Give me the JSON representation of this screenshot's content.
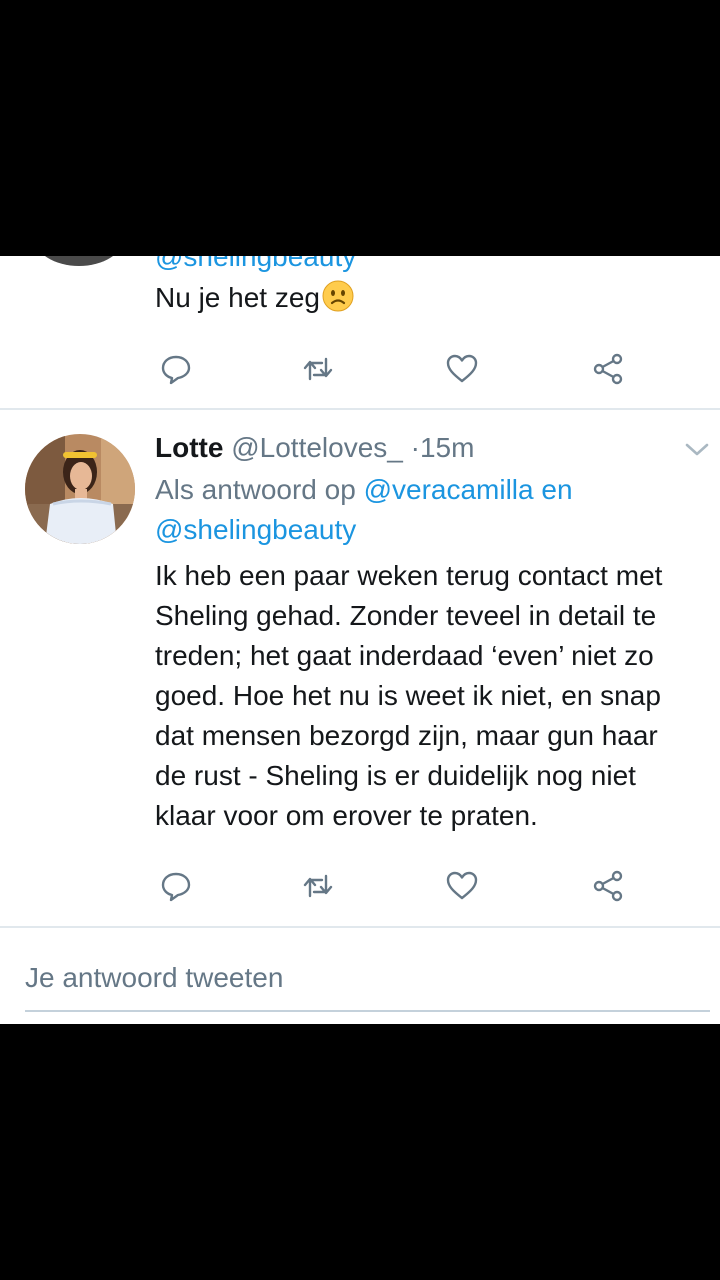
{
  "previous_tweet": {
    "mention_cutoff": "@shelingbeauty",
    "text": "Nu je het zeg",
    "emoji": "frowning-face-emoji"
  },
  "tweet": {
    "name": "Lotte",
    "handle": "@Lotteloves_",
    "separator": "·",
    "time": "15m",
    "reply_prefix": "Als antwoord op",
    "reply_mention_1": "@veracamilla",
    "reply_conjunction": "en",
    "reply_mention_2": "@shelingbeauty",
    "body_lines": [
      "Ik heb een paar weken terug contact met",
      "Sheling gehad. Zonder teveel in detail te",
      "treden; het gaat inderdaad ‘even’ niet zo",
      "goed. Hoe het nu is weet ik niet, en snap",
      "dat mensen bezorgd zijn, maar gun haar",
      "de rust - Sheling is er duidelijk nog niet",
      "klaar voor om erover te praten."
    ]
  },
  "actions": [
    "reply-icon",
    "retweet-icon",
    "like-icon",
    "share-icon"
  ],
  "compose": {
    "placeholder": "Je antwoord tweeten"
  },
  "colors": {
    "link": "#1b95e0",
    "secondary": "#657786",
    "text": "#14171a",
    "icon": "#657786"
  }
}
